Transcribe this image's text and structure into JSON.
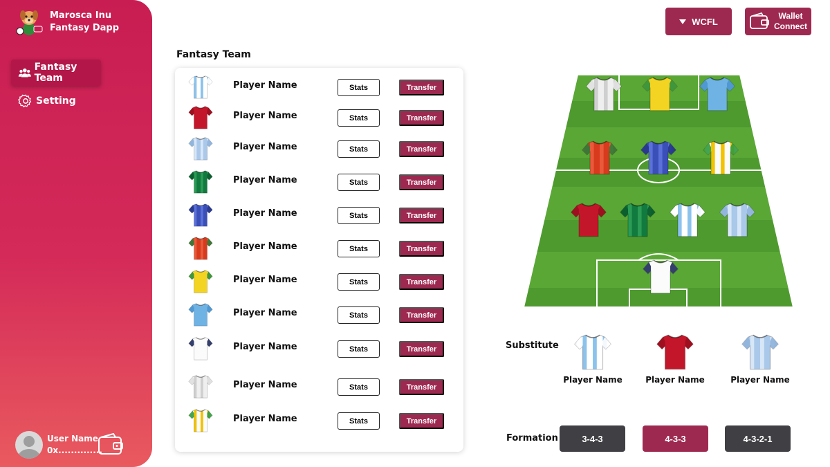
{
  "brand": {
    "line1": "Marosca Inu",
    "line2": "Fantasy Dapp"
  },
  "nav": {
    "fantasy_team": "Fantasy Team",
    "setting": "Setting"
  },
  "user": {
    "name": "User Name",
    "address": "0x.............."
  },
  "header": {
    "league": "WCFL",
    "wallet_line1": "Wallet",
    "wallet_line2": "Connect"
  },
  "team": {
    "title": "Fantasy Team",
    "stats_label": "Stats",
    "transfer_label": "Transfer",
    "players": [
      {
        "name": "Player Name",
        "kit": "argentina"
      },
      {
        "name": "Player Name",
        "kit": "red"
      },
      {
        "name": "Player Name",
        "kit": "lightblue-pattern"
      },
      {
        "name": "Player Name",
        "kit": "green"
      },
      {
        "name": "Player Name",
        "kit": "navy-blue"
      },
      {
        "name": "Player Name",
        "kit": "morocco-red"
      },
      {
        "name": "Player Name",
        "kit": "yellow"
      },
      {
        "name": "Player Name",
        "kit": "sky-blue"
      },
      {
        "name": "Player Name",
        "kit": "white-england"
      },
      {
        "name": "Player Name",
        "kit": "white-grey"
      },
      {
        "name": "Player Name",
        "kit": "white-green"
      }
    ]
  },
  "pitch": {
    "lineup_kits": [
      "white-grey",
      "yellow",
      "sky-blue",
      "morocco-red",
      "navy-blue",
      "white-green",
      "red",
      "green",
      "argentina",
      "lightblue-pattern",
      "white-england"
    ]
  },
  "substitutes": {
    "label": "Substitute",
    "players": [
      {
        "name": "Player Name",
        "kit": "argentina"
      },
      {
        "name": "Player Name",
        "kit": "red"
      },
      {
        "name": "Player Name",
        "kit": "lightblue-pattern"
      }
    ]
  },
  "formation": {
    "label": "Formation",
    "options": [
      "3-4-3",
      "4-3-3",
      "4-3-2-1"
    ],
    "selected": "4-3-3"
  },
  "colors": {
    "accent": "#9e2950",
    "sidebar_top": "#c81d52",
    "sidebar_bottom": "#e95a5e",
    "pitch_green": "#4e9a2f"
  }
}
